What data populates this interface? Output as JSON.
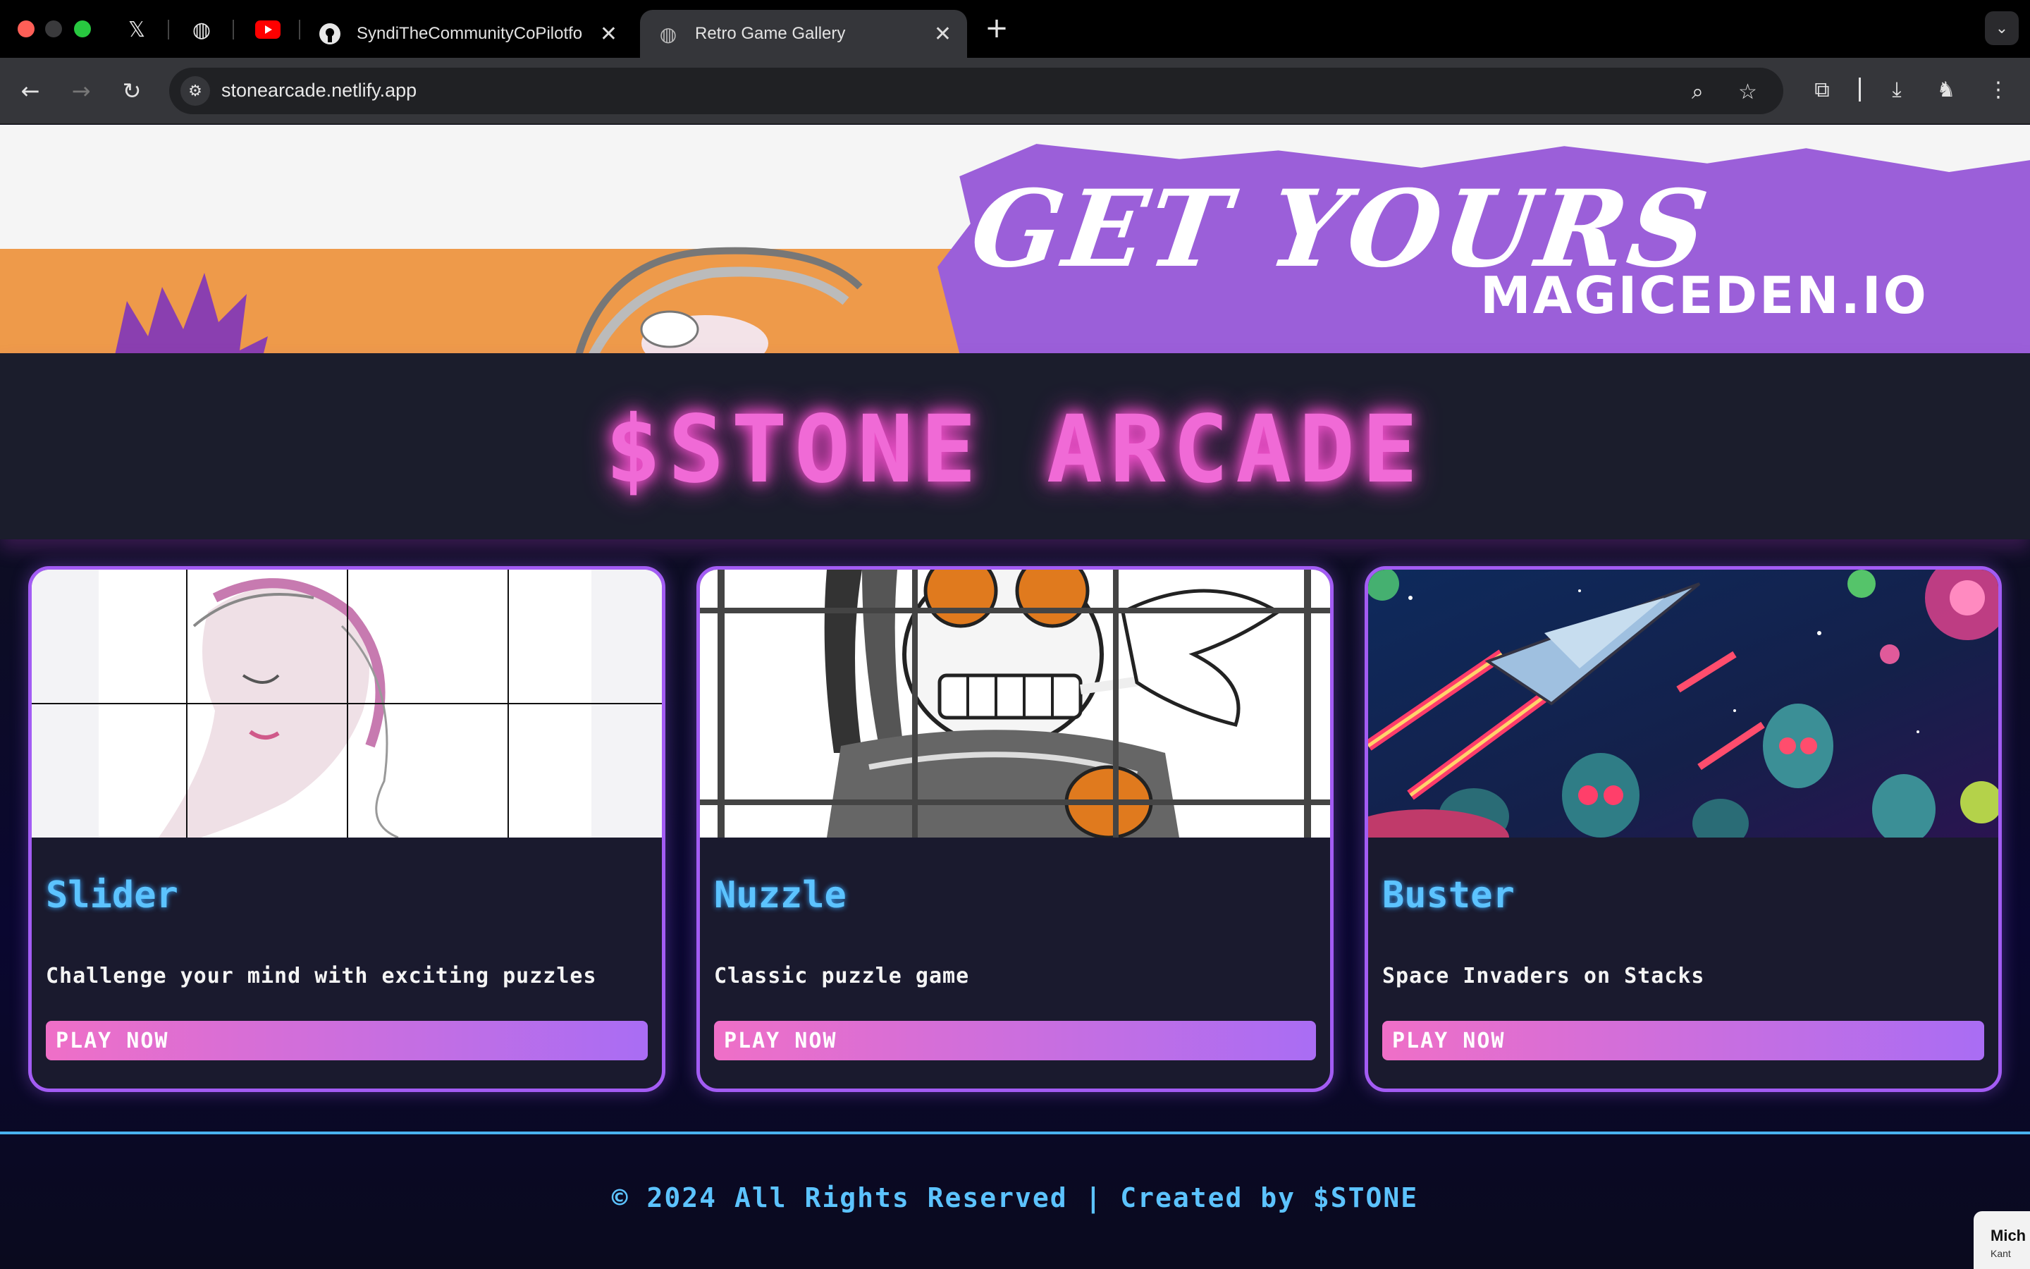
{
  "browser": {
    "tabs": [
      {
        "icon": "x-logo-icon",
        "glyph": "𝕏"
      },
      {
        "icon": "globe-icon",
        "glyph": "◍"
      },
      {
        "icon": "youtube-icon",
        "glyph": "▶"
      },
      {
        "icon": "github-icon",
        "title": "SyndiTheCommunityCoPilotfo"
      },
      {
        "icon": "globe-icon",
        "title": "Retro Game Gallery",
        "active": true
      }
    ],
    "new_tab": "+",
    "tab_menu": "⌄",
    "url": "stonearcade.netlify.app"
  },
  "banner": {
    "headline": "GET YOURS",
    "site": "MAGICEDEN.IO",
    "colors": {
      "purple": "#9b5fd9",
      "orange": "#ee9a4a"
    }
  },
  "title": "$STONE ARCADE",
  "games": [
    {
      "name": "Slider",
      "description": "Challenge your mind with exciting puzzles",
      "button": "PLAY NOW"
    },
    {
      "name": "Nuzzle",
      "description": "Classic puzzle game",
      "button": "PLAY NOW"
    },
    {
      "name": "Buster",
      "description": "Space Invaders on Stacks",
      "button": "PLAY NOW"
    }
  ],
  "footer": "© 2024 All Rights Reserved | Created by $STONE",
  "corner": {
    "line1": "Mich",
    "line2": "Kant"
  },
  "colors": {
    "accent_pink": "#f06ad6",
    "accent_purple": "#a35cf4",
    "accent_blue": "#5cc3ff"
  }
}
